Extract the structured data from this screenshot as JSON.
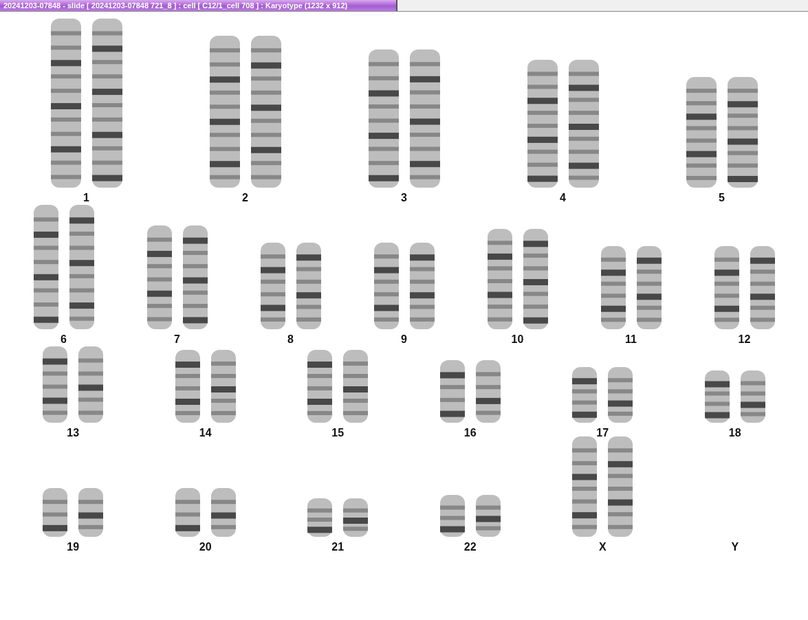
{
  "window": {
    "title": "20241203-07848 - slide [ 20241203-07848 721_8 ] : cell [ C12/1_cell 708 ] : Karyotype  (1232 x 912)"
  },
  "karyotype": {
    "rows": [
      {
        "pairs": [
          {
            "label": "1"
          },
          {
            "label": "2"
          },
          {
            "label": "3"
          },
          {
            "label": "4"
          },
          {
            "label": "5"
          }
        ]
      },
      {
        "pairs": [
          {
            "label": "6"
          },
          {
            "label": "7"
          },
          {
            "label": "8"
          },
          {
            "label": "9"
          },
          {
            "label": "10"
          },
          {
            "label": "11"
          },
          {
            "label": "12"
          }
        ]
      },
      {
        "pairs": [
          {
            "label": "13"
          },
          {
            "label": "14"
          },
          {
            "label": "15"
          },
          {
            "label": "16"
          },
          {
            "label": "17"
          },
          {
            "label": "18"
          }
        ]
      },
      {
        "pairs": [
          {
            "label": "19"
          },
          {
            "label": "20"
          },
          {
            "label": "21"
          },
          {
            "label": "22"
          },
          {
            "label": "X"
          },
          {
            "label": "Y"
          }
        ]
      }
    ]
  }
}
